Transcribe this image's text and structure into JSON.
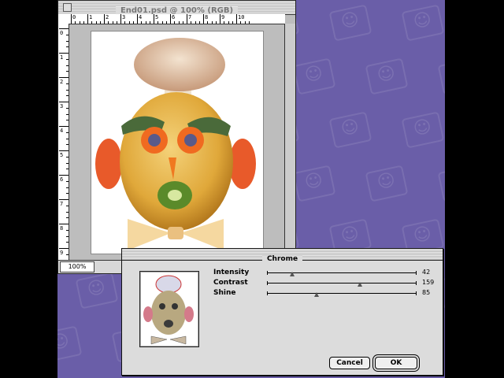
{
  "document_window": {
    "title": "End01.psd @ 100% (RGB)",
    "zoom": "100%",
    "ruler_h_labels": [
      "0",
      "1",
      "2",
      "3",
      "4",
      "5",
      "6",
      "7",
      "8",
      "9",
      "10"
    ],
    "ruler_v_labels": [
      "0",
      "1",
      "2",
      "3",
      "4",
      "5",
      "6",
      "7",
      "8",
      "9"
    ]
  },
  "dialog": {
    "title": "Chrome",
    "sliders": [
      {
        "label": "Intensity",
        "value": "42",
        "fraction": 0.17
      },
      {
        "label": "Contrast",
        "value": "159",
        "fraction": 0.62
      },
      {
        "label": "Shine",
        "value": "85",
        "fraction": 0.33
      }
    ],
    "cancel_label": "Cancel",
    "ok_label": "OK"
  },
  "icons": {
    "desktop_pattern": "mac-os-logo-icon",
    "close": "close-box-icon"
  },
  "colors": {
    "desktop": "#6a5ea8",
    "window_gray": "#bdbdbd"
  }
}
